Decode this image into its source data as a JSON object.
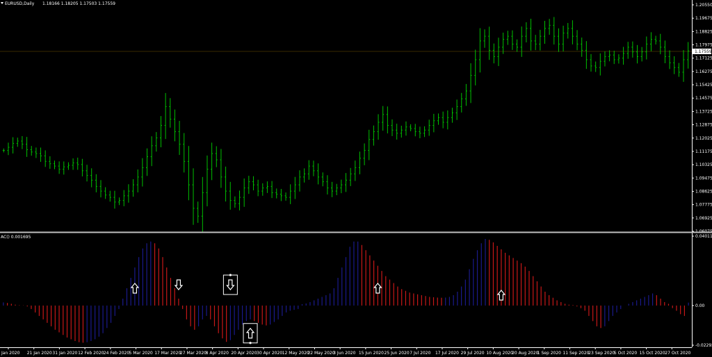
{
  "header": {
    "dropdown_icon": "triangle-down-icon",
    "symbol_title": "EURUSD,Daily",
    "ohlc_values": "1.18166 1.18205 1.17503 1.17559"
  },
  "indicator": {
    "title": "AC() 0.001695"
  },
  "price_axis": {
    "labels": [
      "1.20550",
      "1.19675",
      "1.18825",
      "1.17975",
      "1.17125",
      "1.16275",
      "1.15425",
      "1.14575",
      "1.13725",
      "1.12875",
      "1.12025",
      "1.11175",
      "1.10325",
      "1.09475",
      "1.08625",
      "1.07775",
      "1.06925",
      "1.06075"
    ],
    "current_price": "1.17559"
  },
  "indicator_axis": {
    "labels": [
      "0.040118",
      "0.00",
      "-0.022924"
    ]
  },
  "time_axis": {
    "labels": [
      "Jan 2020",
      "21 Jan 2020",
      "31 Jan 2020",
      "12 Feb 2020",
      "24 Feb 2020",
      "5 Mar 2020",
      "17 Mar 2020",
      "27 Mar 2020",
      "8 Apr 2020",
      "20 Apr 2020",
      "30 Apr 2020",
      "12 May 2020",
      "22 May 2020",
      "3 Jun 2020",
      "15 Jun 2020",
      "25 Jun 2020",
      "7 Jul 2020",
      "17 Jul 2020",
      "29 Jul 2020",
      "10 Aug 2020",
      "20 Aug 2020",
      "1 Sep 2020",
      "11 Sep 2020",
      "23 Sep 2020",
      "5 Oct 2020",
      "15 Oct 2020",
      "27 Oct 2020"
    ]
  },
  "signals": [
    {
      "type": "up",
      "bar": 33,
      "level": 0.01
    },
    {
      "type": "down",
      "bar": 44,
      "level": 0.012
    },
    {
      "type": "down",
      "bar": 57,
      "level": 0.012,
      "boxed": true
    },
    {
      "type": "up",
      "bar": 62,
      "level": -0.016,
      "boxed": true
    },
    {
      "type": "up",
      "bar": 94,
      "level": 0.01
    },
    {
      "type": "up",
      "bar": 125,
      "level": 0.006
    }
  ],
  "colors": {
    "background": "#000000",
    "candle": "#00c000",
    "ac_up": "#1a1a8c",
    "ac_down": "#c81818",
    "axis": "#ffffff",
    "separator": "#bfbfbf",
    "price_line": "#3a2a00"
  },
  "chart_data": [
    {
      "type": "bar",
      "title": "EURUSD,Daily",
      "ylim": [
        1.06075,
        1.2055
      ],
      "current_price": 1.17559,
      "close": [
        1.112,
        1.114,
        1.1165,
        1.118,
        1.116,
        1.1125,
        1.111,
        1.11,
        1.1085,
        1.105,
        1.1035,
        1.102,
        1.1,
        1.1015,
        1.1025,
        1.104,
        1.103,
        1.099,
        1.096,
        1.093,
        1.089,
        1.086,
        1.0835,
        1.082,
        1.079,
        1.08,
        1.083,
        1.086,
        1.09,
        1.095,
        1.101,
        1.108,
        1.115,
        1.12,
        1.128,
        1.14,
        1.132,
        1.124,
        1.116,
        1.105,
        1.09,
        1.075,
        1.07,
        1.085,
        1.1,
        1.11,
        1.106,
        1.095,
        1.086,
        1.08,
        1.078,
        1.082,
        1.088,
        1.092,
        1.09,
        1.086,
        1.088,
        1.089,
        1.085,
        1.084,
        1.083,
        1.082,
        1.086,
        1.09,
        1.095,
        1.097,
        1.102,
        1.099,
        1.095,
        1.092,
        1.088,
        1.086,
        1.088,
        1.09,
        1.093,
        1.097,
        1.101,
        1.107,
        1.112,
        1.119,
        1.124,
        1.13,
        1.135,
        1.128,
        1.125,
        1.123,
        1.125,
        1.127,
        1.126,
        1.124,
        1.123,
        1.125,
        1.128,
        1.131,
        1.133,
        1.13,
        1.133,
        1.136,
        1.14,
        1.145,
        1.15,
        1.16,
        1.17,
        1.182,
        1.185,
        1.176,
        1.172,
        1.178,
        1.183,
        1.185,
        1.18,
        1.178,
        1.185,
        1.19,
        1.182,
        1.18,
        1.185,
        1.19,
        1.192,
        1.185,
        1.18,
        1.187,
        1.19,
        1.185,
        1.18,
        1.176,
        1.17,
        1.166,
        1.165,
        1.169,
        1.172,
        1.173,
        1.17,
        1.171,
        1.174,
        1.178,
        1.175,
        1.172,
        1.175,
        1.18,
        1.183,
        1.182,
        1.178,
        1.172,
        1.168,
        1.165,
        1.162,
        1.17,
        1.1756
      ]
    },
    {
      "type": "bar",
      "title": "AC()",
      "ylim": [
        -0.022924,
        0.040118
      ],
      "current_value": 0.001695,
      "values": [
        0.0018,
        0.0015,
        0.001,
        0.0005,
        0.0002,
        0.0001,
        -0.0005,
        -0.002,
        -0.004,
        -0.006,
        -0.008,
        -0.01,
        -0.012,
        -0.014,
        -0.0155,
        -0.017,
        -0.0185,
        -0.0195,
        -0.0205,
        -0.0212,
        -0.0215,
        -0.0212,
        -0.0205,
        -0.0195,
        -0.018,
        -0.016,
        -0.013,
        -0.01,
        -0.006,
        -0.002,
        0.004,
        0.01,
        0.016,
        0.022,
        0.028,
        0.033,
        0.036,
        0.037,
        0.036,
        0.033,
        0.028,
        0.022,
        0.016,
        0.01,
        0.004,
        -0.002,
        -0.008,
        -0.012,
        -0.014,
        -0.012,
        -0.008,
        -0.006,
        -0.008,
        -0.012,
        -0.016,
        -0.019,
        -0.021,
        -0.02,
        -0.017,
        -0.014,
        -0.011,
        -0.009,
        -0.008,
        -0.009,
        -0.01,
        -0.011,
        -0.0115,
        -0.011,
        -0.0095,
        -0.008,
        -0.006,
        -0.004,
        -0.003,
        -0.0025,
        -0.002,
        0.0008,
        0.0012,
        0.002,
        0.003,
        0.004,
        0.005,
        0.006,
        0.007,
        0.01,
        0.016,
        0.022,
        0.028,
        0.034,
        0.037,
        0.037,
        0.035,
        0.032,
        0.029,
        0.026,
        0.023,
        0.02,
        0.017,
        0.015,
        0.013,
        0.011,
        0.0095,
        0.0085,
        0.0075,
        0.007,
        0.0065,
        0.006,
        0.0055,
        0.005,
        0.0048,
        0.0046,
        0.0045,
        0.0046,
        0.005,
        0.006,
        0.008,
        0.011,
        0.015,
        0.021,
        0.027,
        0.032,
        0.036,
        0.0385,
        0.038,
        0.0365,
        0.0345,
        0.0325,
        0.0305,
        0.029,
        0.0275,
        0.026,
        0.0245,
        0.0225,
        0.02,
        0.017,
        0.014,
        0.011,
        0.008,
        0.006,
        0.0045,
        0.003,
        0.002,
        0.001,
        0.0005,
        0.0003,
        -0.0005,
        -0.0015,
        -0.003,
        -0.006,
        -0.009,
        -0.012,
        -0.013,
        -0.012,
        -0.009,
        -0.006,
        -0.004,
        -0.002,
        0.0,
        0.001,
        0.002,
        0.003,
        0.004,
        0.005,
        0.006,
        0.007,
        0.006,
        0.004,
        0.002,
        0.001,
        -0.0015,
        -0.003,
        -0.005,
        -0.006,
        0.0017
      ]
    }
  ]
}
